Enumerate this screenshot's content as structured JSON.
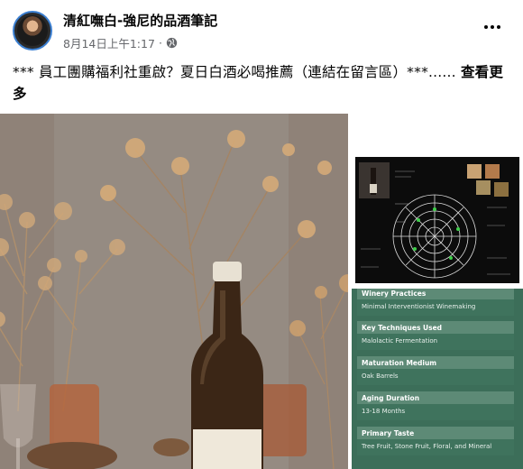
{
  "post": {
    "page_name": "清紅嘸白-強尼的品酒筆記",
    "date": "8月14日上午1:17",
    "separator": "·",
    "text": "*** 員工團購福利社重啟？夏日白酒必喝推薦（連結在留言區）***......",
    "see_more_label": "查看更多"
  },
  "icons": {
    "globe": "globe-icon",
    "more": "more-options-icon"
  },
  "wine_info": [
    {
      "label": "Winery Practices",
      "value": "Minimal Interventionist Winemaking"
    },
    {
      "label": "Key Techniques Used",
      "value": "Malolactic Fermentation"
    },
    {
      "label": "Maturation Medium",
      "value": "Oak Barrels"
    },
    {
      "label": "Aging Duration",
      "value": "13-18 Months"
    },
    {
      "label": "Primary Taste",
      "value": "Tree Fruit, Stone Fruit, Floral, and Mineral"
    }
  ],
  "colors": {
    "link_blue": "#3b7fd1",
    "meta_gray": "#65676b",
    "panel_green": "#3f735d",
    "panel_head_green": "#5d8a76"
  }
}
